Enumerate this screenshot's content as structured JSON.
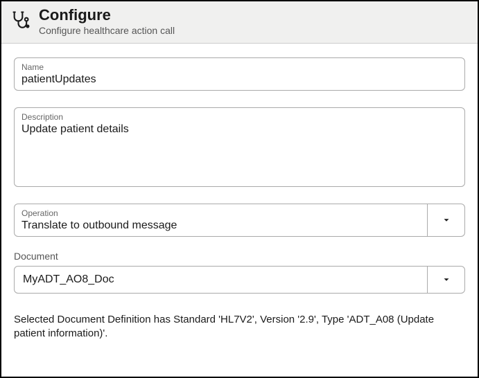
{
  "header": {
    "title": "Configure",
    "subtitle": "Configure healthcare action call"
  },
  "form": {
    "name": {
      "label": "Name",
      "value": "patientUpdates"
    },
    "description": {
      "label": "Description",
      "value": "Update patient details"
    },
    "operation": {
      "label": "Operation",
      "value": "Translate to outbound message"
    },
    "document": {
      "label": "Document",
      "value": "MyADT_AO8_Doc"
    }
  },
  "info_text": "Selected Document Definition has Standard 'HL7V2', Version '2.9', Type 'ADT_A08 (Update patient information)'."
}
